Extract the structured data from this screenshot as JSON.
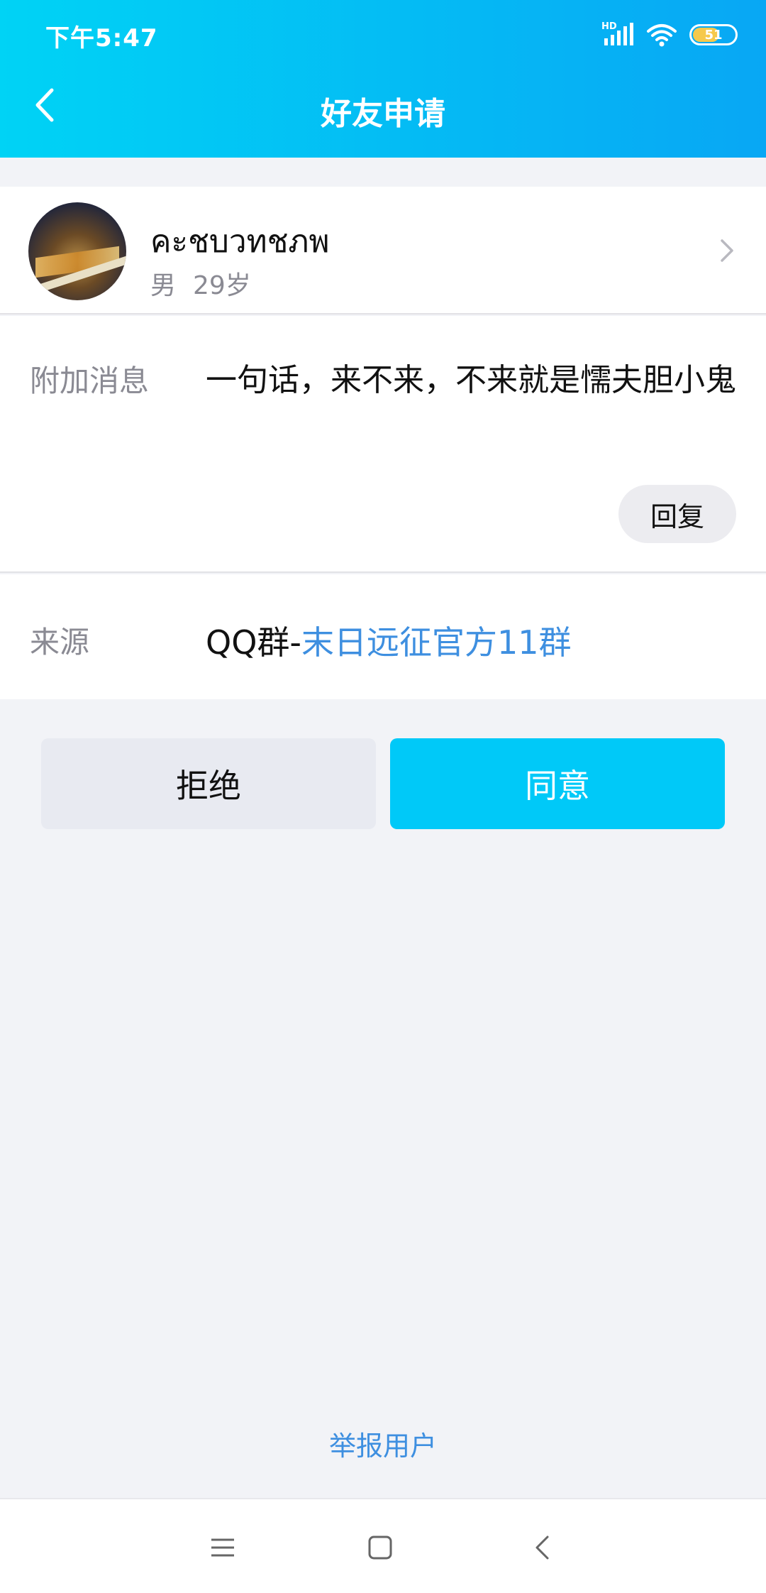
{
  "status_bar": {
    "time": "下午5:47",
    "network_label": "HD",
    "battery_level": "51",
    "icons": [
      "signal-icon",
      "wifi-icon",
      "battery-icon"
    ]
  },
  "header": {
    "title": "好友申请",
    "back_icon": "chevron-left-icon"
  },
  "profile": {
    "name": "คะชบวทชภพ",
    "gender": "男",
    "age": "29岁"
  },
  "message": {
    "label": "附加消息",
    "text": "一句话，来不来，不来就是懦夫胆小鬼",
    "reply_label": "回复"
  },
  "source": {
    "label": "来源",
    "prefix": "QQ群-",
    "group_name": "末日远征官方11群"
  },
  "actions": {
    "reject_label": "拒绝",
    "agree_label": "同意"
  },
  "footer": {
    "report_label": "举报用户"
  },
  "colors": {
    "header_start": "#00d3f5",
    "header_end": "#08a7f4",
    "agree_button": "#00c9f8",
    "link": "#3e8fe0"
  }
}
